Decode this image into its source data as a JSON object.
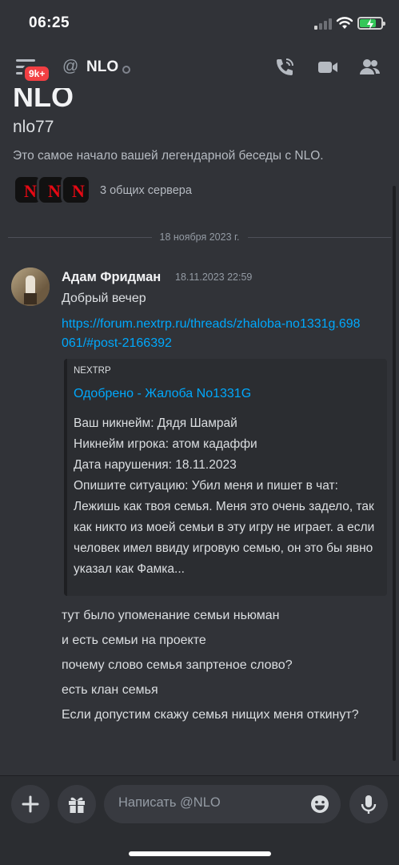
{
  "status_bar": {
    "time": "06:25"
  },
  "header": {
    "badge": "9k+",
    "at_symbol": "@",
    "title": "NLO",
    "icons": [
      "hamburger-icon",
      "call-icon",
      "video-icon",
      "members-icon"
    ]
  },
  "intro": {
    "name": "NLO",
    "username": "nlo77",
    "description": "Это самое начало вашей легендарной беседы с NLO.",
    "common_servers": "3 общих сервера"
  },
  "divider_date": "18 ноября 2023 г.",
  "message": {
    "author": "Адам Фридман",
    "timestamp": "18.11.2023 22:59",
    "text": "Добрый вечер",
    "link": "https://forum.nextrp.ru/threads/zhaloba-no1331g.698061/#post-2166392",
    "embed": {
      "provider": "NEXTRP",
      "title": "Одобрено - Жалоба No1331G",
      "lines": [
        "Ваш никнейм: Дядя Шамрай",
        "Никнейм игрока: атом кадаффи",
        "Дата нарушения: 18.11.2023",
        "Опишите ситуацию: Убил меня и пишет в чат: Лежишь как твоя семья. Меня это очень задело, так как никто из моей семьи в эту игру не играет. а если человек имел ввиду игровую семью, он это бы явно указал как Фамка..."
      ]
    },
    "followups": [
      "тут было упоменание семьи ньюман",
      "и есть семьи на проекте",
      "почему слово семья запртеное слово?",
      "есть клан семья",
      "Если допустим скажу семья нищих меня откинут?"
    ]
  },
  "composer": {
    "placeholder": "Написать @NLO"
  },
  "colors": {
    "background": "#313338",
    "link": "#00a8fc",
    "badge": "#f23f43"
  }
}
